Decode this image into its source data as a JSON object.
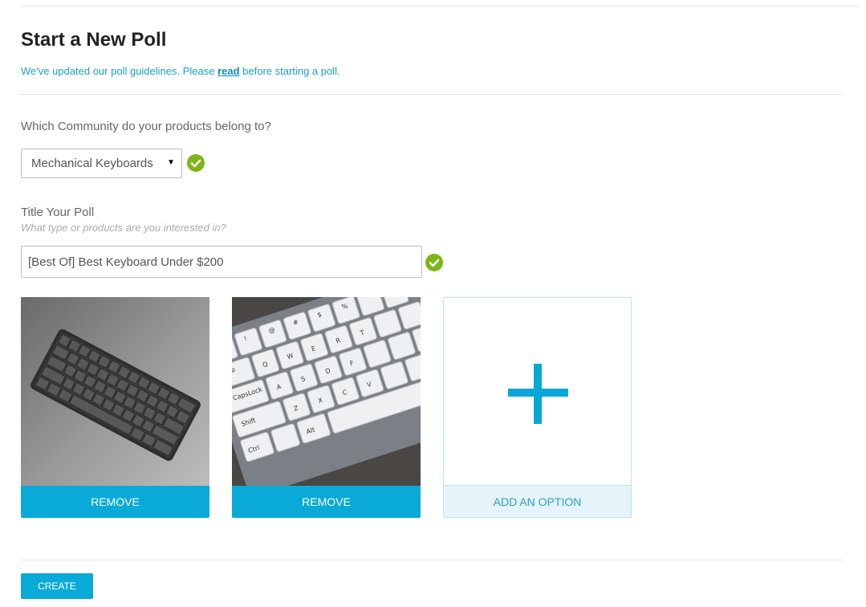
{
  "page": {
    "title": "Start a New Poll",
    "notice_before": "We've updated our poll guidelines. Please ",
    "notice_link": "read",
    "notice_after": " before starting a poll."
  },
  "community": {
    "label": "Which Community do your products belong to?",
    "selected": "Mechanical Keyboards",
    "valid_icon": "check-circle-icon"
  },
  "poll_title": {
    "label": "Title Your Poll",
    "hint": "What type or products are you interested in?",
    "value": "[Best Of] Best Keyboard Under $200",
    "valid_icon": "check-circle-icon"
  },
  "options": [
    {
      "image": "dark-gray-60-percent-keyboard-photo",
      "button": "REMOVE"
    },
    {
      "image": "white-keycap-keyboard-closeup-photo",
      "button": "REMOVE"
    }
  ],
  "add_option": {
    "icon": "plus-icon",
    "button": "ADD AN OPTION"
  },
  "actions": {
    "create": "CREATE"
  },
  "colors": {
    "accent": "#0aaad8",
    "link": "#16a0cf",
    "check": "#7cb518",
    "add_bg": "#e4f4fa"
  }
}
